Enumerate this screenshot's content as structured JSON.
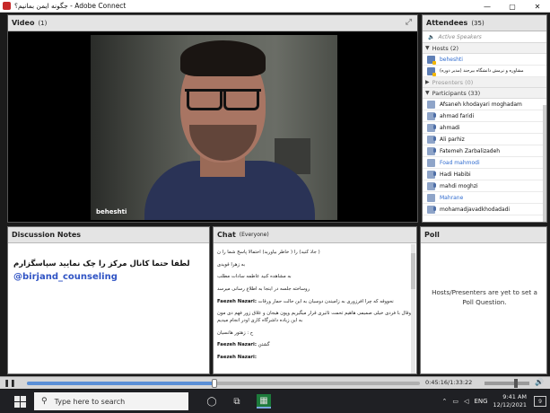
{
  "window": {
    "title": "جگونه ایمن بمانیم؟ - Adobe Connect",
    "min": "—",
    "max": "▢",
    "close": "✕"
  },
  "video": {
    "title": "Video",
    "count": "(1)",
    "presenter_name": "beheshti"
  },
  "attendees": {
    "title": "Attendees",
    "count": "(35)",
    "active_speakers": "Active Speakers",
    "hosts_label": "Hosts (2)",
    "hosts": [
      "beheshti",
      "(مدیر دوره) مشاوره و نرمش دانشگاه بیرجند"
    ],
    "presenters_label": "Presenters (0)",
    "participants_label": "Participants (33)",
    "participants": [
      "Afsaneh khodayari moghadam",
      "ahmad faridi",
      "ahmadi",
      "Ali parhiz",
      "Fatemeh Zarbalizadeh",
      "Foad mahmodi",
      "Hadi Habibi",
      "mahdi moghzi",
      "Mahrane",
      "mohamadjavadkhodadadi"
    ]
  },
  "notes": {
    "title": "Discussion Notes",
    "line1": "لطفا حتما کانال مرکز را چک نمایید سپاسگزارم",
    "line2": "@birjand_counseling"
  },
  "chat": {
    "title": "Chat",
    "scope": "(Everyone)",
    "messages": [
      {
        "who": "",
        "text": "( جاذ کنید) را ( خاطر بیاورید) احتمالا پاسخ شما را ن"
      },
      {
        "who": "",
        "text": "به زهرا قویدی"
      },
      {
        "who": "",
        "text": "به مشاهده کنید عاطمه سادات مطلب"
      },
      {
        "who": "",
        "text": "روساخته جلسه در اینجا به اطلاع رسانی میرسد"
      },
      {
        "who": "Faezeh Nazari:",
        "text": "نحووقه که چرا افرزوری به زامیندن دوسیان به این حالت حمار ورقات"
      },
      {
        "who": "",
        "text": "وقال با فردی خیلی صمیمی هاهیم تحمت تاثیری قرار میگیریم وپون هیجان و علاق زور فهم دی مون به این زیاده داشرگاه کاری اودر انجام میدیم"
      },
      {
        "who": "",
        "text": "ح : زهتور هانسیان"
      },
      {
        "who": "Faezeh Nazari:",
        "text": "گشتن"
      },
      {
        "who": "Faezeh Nazari:",
        "text": ""
      }
    ]
  },
  "poll": {
    "title": "Poll",
    "message": "Hosts/Presenters are yet to set a Poll Question."
  },
  "playback": {
    "pause_symbol": "❚❚",
    "progress": 0.478,
    "time": "0:45:16/1:33:22",
    "volume": 0.7
  },
  "taskbar": {
    "search_placeholder": "Type here to search",
    "time": "9:41 AM",
    "date": "12/12/2021",
    "lang": "ENG",
    "notif_count": "9"
  }
}
